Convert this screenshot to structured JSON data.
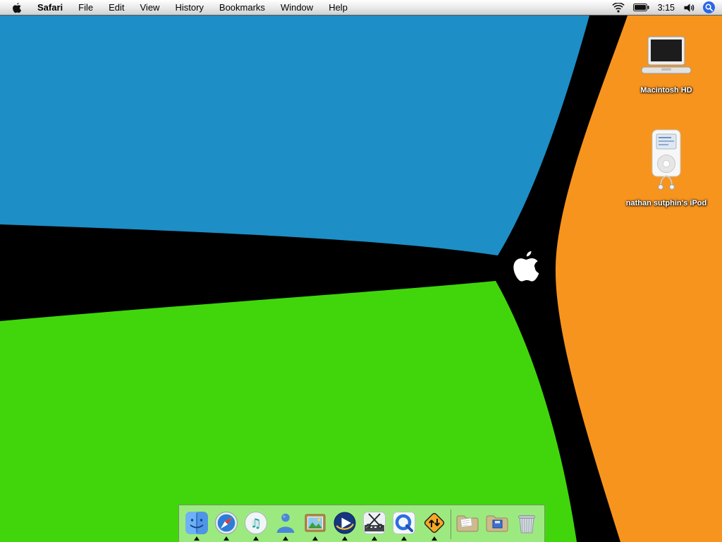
{
  "menu_bar": {
    "app_name": "Safari",
    "menus": [
      "File",
      "Edit",
      "View",
      "History",
      "Bookmarks",
      "Window",
      "Help"
    ],
    "time": "3:15",
    "icons": {
      "apple": "apple-logo",
      "wifi": "airport-signal",
      "battery": "battery-level",
      "volume": "speaker",
      "spotlight": "spotlight-magnifier"
    }
  },
  "desktop": {
    "colors": {
      "background": "#000000",
      "blue": "#1d8ec6",
      "green": "#41d60b",
      "orange": "#f7941e",
      "apple_logo": "#ffffff"
    },
    "icons": [
      {
        "name": "macintosh-hd",
        "label": "Macintosh HD"
      },
      {
        "name": "ipod",
        "label": "nathan sutphin's iPod"
      }
    ]
  },
  "dock": {
    "items": [
      {
        "name": "finder",
        "running": true
      },
      {
        "name": "safari",
        "running": true
      },
      {
        "name": "itunes",
        "running": true
      },
      {
        "name": "ichat",
        "running": true
      },
      {
        "name": "iphoto",
        "running": true
      },
      {
        "name": "realplayer",
        "running": true
      },
      {
        "name": "video-editor",
        "running": true
      },
      {
        "name": "quicktime",
        "running": true
      },
      {
        "name": "road-sign-app",
        "running": true
      },
      {
        "name": "folder-documents",
        "running": false
      },
      {
        "name": "folder-files",
        "running": false
      },
      {
        "name": "trash",
        "running": false
      }
    ]
  }
}
